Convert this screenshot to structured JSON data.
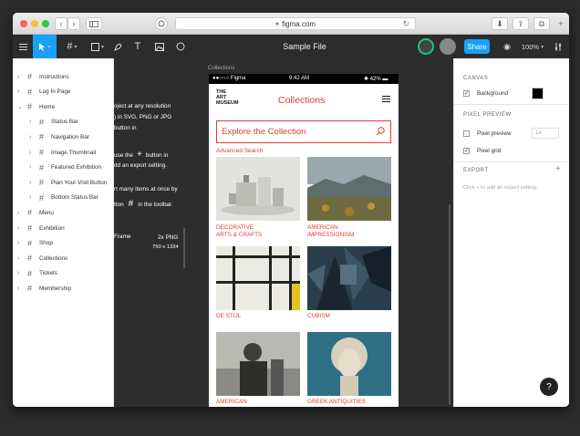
{
  "browser": {
    "url": "figma.com",
    "back_icon": "‹",
    "forward_icon": "›"
  },
  "toolbar": {
    "file_title": "Sample File",
    "share_label": "Share",
    "zoom": "100%"
  },
  "layers": [
    {
      "label": "Instructions",
      "indent": 0,
      "arrow": "›"
    },
    {
      "label": "Log In Page",
      "indent": 0,
      "arrow": "›"
    },
    {
      "label": "Home",
      "indent": 0,
      "arrow": "⌄"
    },
    {
      "label": "Status Bar",
      "indent": 1,
      "arrow": "›"
    },
    {
      "label": "Navigation Bar",
      "indent": 1,
      "arrow": "›"
    },
    {
      "label": "Image Thumbnail",
      "indent": 1,
      "arrow": "›"
    },
    {
      "label": "Featured Exhibition",
      "indent": 1,
      "arrow": "›"
    },
    {
      "label": "Plan Your Visit Button",
      "indent": 1,
      "arrow": "›"
    },
    {
      "label": "Bottom Status Bar",
      "indent": 1,
      "arrow": "›"
    },
    {
      "label": "Menu",
      "indent": 0,
      "arrow": "›"
    },
    {
      "label": "Exhibition",
      "indent": 0,
      "arrow": "›"
    },
    {
      "label": "Shop",
      "indent": 0,
      "arrow": "›"
    },
    {
      "label": "Collections",
      "indent": 0,
      "arrow": "›"
    },
    {
      "label": "Tickets",
      "indent": 0,
      "arrow": "›"
    },
    {
      "label": "Membership",
      "indent": 0,
      "arrow": "›"
    }
  ],
  "canvas": {
    "frame_label": "Collections",
    "instructions": {
      "line1": "oject at any resolution",
      "line2": ") in SVG, PNG or JPG",
      "line3a": "use the",
      "line3b": "button in",
      "line4": "dd an export setting.",
      "line5": "rt many items at once by",
      "line6a": "tton",
      "line6b": "in the toolbar.",
      "frame_word": "Frame",
      "export_format": "2x PNG",
      "export_size": "750 x 1334"
    }
  },
  "phone": {
    "status": {
      "carrier": "●●○○○ Figma",
      "time": "9:42 AM",
      "battery": "42%"
    },
    "logo": [
      "THE",
      "ART",
      "MUSEUM"
    ],
    "title": "Collections",
    "search_text": "Explore the Collection",
    "advanced_search": "Advanced Search",
    "tiles": [
      {
        "label": [
          "DECORATIVE",
          "ARTS & CRAFTS"
        ]
      },
      {
        "label": [
          "AMERICAN",
          "IMPRESSIONISM"
        ]
      },
      {
        "label": [
          "DE STIJL"
        ]
      },
      {
        "label": [
          "CUBISM"
        ]
      },
      {
        "label": [
          "AMERICAN"
        ]
      },
      {
        "label": [
          "GREEK ANTIQUITIES"
        ]
      }
    ]
  },
  "props": {
    "canvas_heading": "CANVAS",
    "background_label": "Background",
    "background_color": "#000000",
    "pixel_preview_heading": "PIXEL PREVIEW",
    "pixel_preview_label": "Pixel preview",
    "pixel_preview_value": "1x",
    "pixel_grid_label": "Pixel grid",
    "export_heading": "EXPORT",
    "export_hint": "Click + to add an export setting."
  },
  "help_label": "?"
}
